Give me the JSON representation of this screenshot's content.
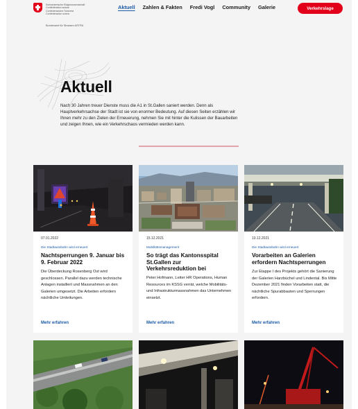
{
  "header": {
    "logo": {
      "lines": [
        "Schweizerische Eidgenossenschaft",
        "Confédération suisse",
        "Confederazione Svizzera",
        "Confederaziun svizra"
      ],
      "office": "Bundesamt für Strassen ASTRA",
      "flag_color": "#e2001a"
    },
    "nav": [
      {
        "label": "Aktuell",
        "active": true
      },
      {
        "label": "Zahlen & Fakten",
        "active": false
      },
      {
        "label": "Fredi Vogl",
        "active": false
      },
      {
        "label": "Community",
        "active": false
      },
      {
        "label": "Galerie",
        "active": false
      }
    ],
    "cta_label": "Verkehrslage"
  },
  "hero": {
    "title": "Aktuell",
    "intro": "Nach 30 Jahren treuer Dienste muss die A1 in St.Gallen saniert werden. Denn als Hauptverkehrsachse der Stadt ist sie von enormer Bedeutung. Auf diesen Seiten erzählen wir Ihnen mehr zu den Zielen der Erneuerung, nehmen Sie mit hinter die Kulissen der Bauarbeiten und zeigen Ihnen, wie ein Verkehrschaos vermieden werden kann."
  },
  "cards": [
    {
      "date": "07.01.2022",
      "tag": "Die Stadtautobahn wird erneuert",
      "title": "Nachtsperrungen 9. Januar bis 9. Februar 2022",
      "body": "Die Überdeckung Rosenberg Ost wird geschlossen. Parallel dazu werden technische Anlagen installiert und Massnahmen an den Galerien umgesetzt. Die Arbeiten erfordern nächtliche Umleitungen.",
      "more": "Mehr erfahren",
      "image": "night-tunnel-traffic-cone"
    },
    {
      "date": "15.12.2021",
      "tag": "Mobilitätsmanagement",
      "title": "So trägt das Kantonsspital St.Gallen zur Verkehrsreduktion bei",
      "body": "Peter Hofmann, Leiter HR Operations, Human Resources im KSSG verrät, welche Mobilitäts- und Infrastrukturmassnahmen das Unternehmen einsetzt.",
      "more": "Mehr erfahren",
      "image": "aerial-hospital-city"
    },
    {
      "date": "10.12.2021",
      "tag": "Die Stadtautobahn wird erneuert",
      "title": "Vorarbeiten an Galerien erfordern Nachtsperrungen",
      "body": "Zur Etappe I des Projekts gehört die Sanierung der Galerien Harzbüchel und Lindental. Bis Mitte Dezember 2021 finden Vorarbeiten statt, die nächtliche Spurabbauten und Sperrungen erfordern.",
      "more": "Mehr erfahren",
      "image": "highway-gallery-dusk"
    }
  ],
  "row2_images": [
    "aerial-highway-forest",
    "bridge-construction-night",
    "red-crane-night"
  ],
  "colors": {
    "accent": "#1a5aa6",
    "brand_red": "#e2001a",
    "page_bg": "#f4f4f4"
  }
}
